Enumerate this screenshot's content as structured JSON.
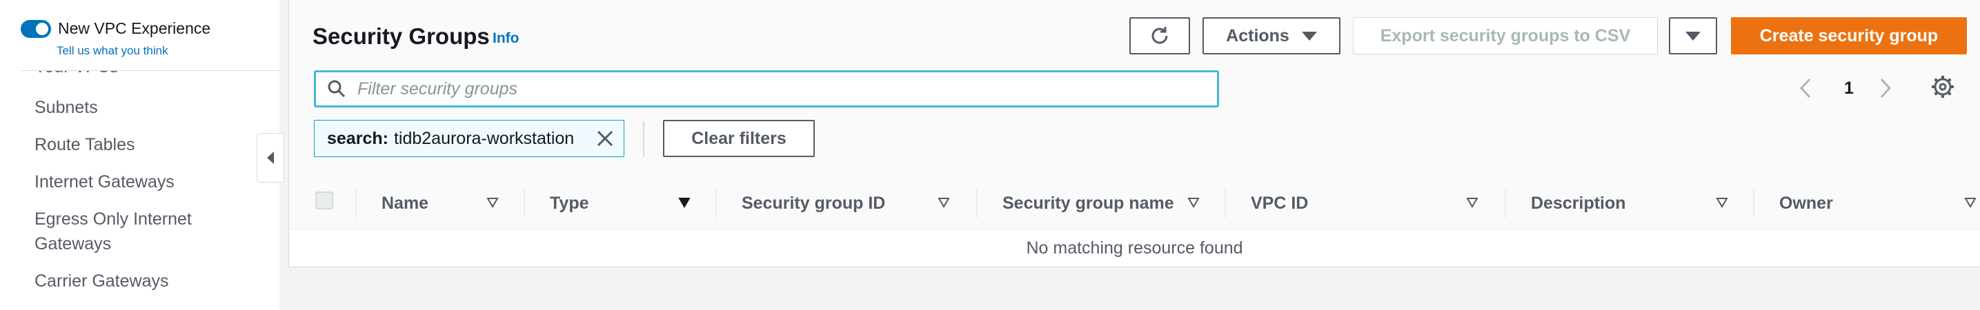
{
  "sidebar": {
    "toggle_label": "New VPC Experience",
    "feedback_link": "Tell us what you think",
    "clipped_item": "Your VPCs",
    "items": [
      {
        "label": "Subnets"
      },
      {
        "label": "Route Tables"
      },
      {
        "label": "Internet Gateways"
      },
      {
        "label": "Egress Only Internet Gateways"
      },
      {
        "label": "Carrier Gateways"
      }
    ]
  },
  "header": {
    "title": "Security Groups",
    "info": "Info"
  },
  "toolbar": {
    "actions_label": "Actions",
    "export_label": "Export security groups to CSV",
    "create_label": "Create security group"
  },
  "search": {
    "placeholder": "Filter security groups",
    "value": ""
  },
  "filter_token": {
    "key": "search:",
    "value": "tidb2aurora-workstation"
  },
  "clear_filters_label": "Clear filters",
  "pagination": {
    "current_page": "1"
  },
  "table": {
    "columns": [
      "Name",
      "Type",
      "Security group ID",
      "Security group name",
      "VPC ID",
      "Description",
      "Owner"
    ],
    "empty_message": "No matching resource found"
  },
  "colors": {
    "primary": "#ec7211",
    "link": "#0073bb",
    "focus": "#44b9d6",
    "toggle": "#0073bb"
  },
  "icons": {
    "refresh": "refresh-icon",
    "search": "search-icon",
    "close": "close-icon",
    "settings": "gear-icon",
    "prev": "chevron-left-icon",
    "next": "chevron-right-icon",
    "collapse": "caret-left-icon"
  }
}
